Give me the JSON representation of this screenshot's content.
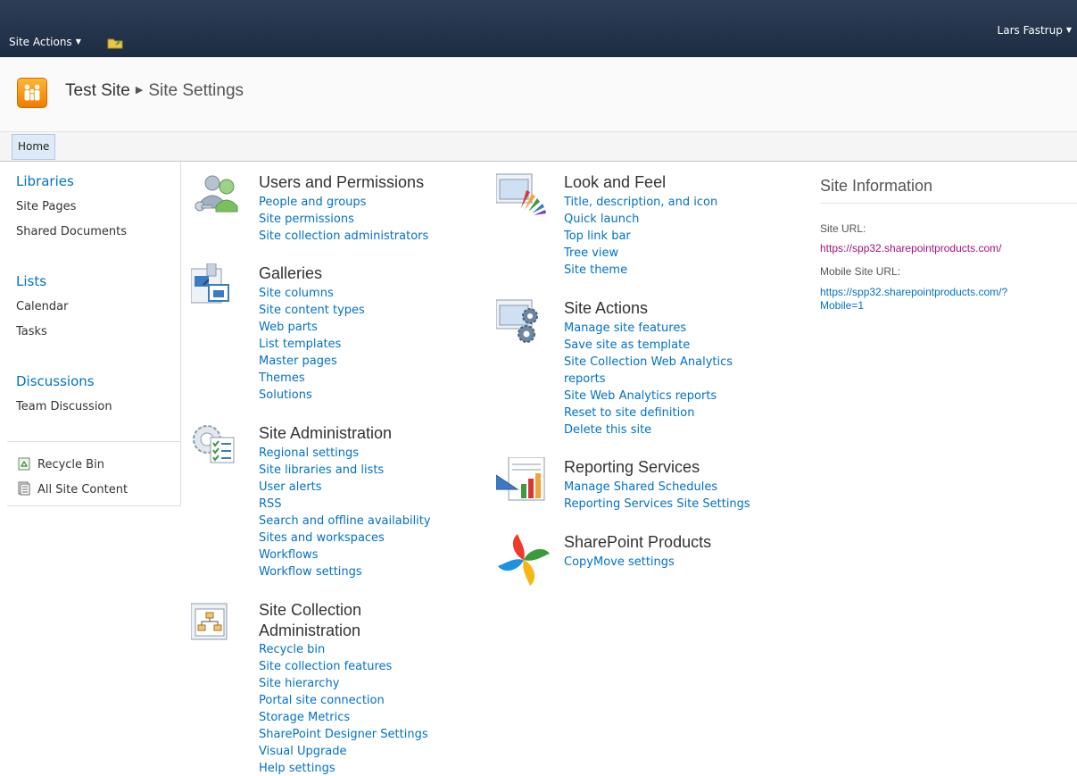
{
  "ribbon": {
    "site_actions_label": "Site Actions",
    "user_name": "Lars Fastrup"
  },
  "breadcrumb": {
    "site": "Test Site",
    "page": "Site Settings"
  },
  "topnav": {
    "home_label": "Home"
  },
  "quicklaunch": {
    "libraries_heading": "Libraries",
    "libraries": [
      "Site Pages",
      "Shared Documents"
    ],
    "lists_heading": "Lists",
    "lists": [
      "Calendar",
      "Tasks"
    ],
    "discussions_heading": "Discussions",
    "discussions": [
      "Team Discussion"
    ],
    "recycle_bin": "Recycle Bin",
    "all_site_content": "All Site Content"
  },
  "sections": {
    "users": {
      "title": "Users and Permissions",
      "links": [
        "People and groups",
        "Site permissions",
        "Site collection administrators"
      ]
    },
    "galleries": {
      "title": "Galleries",
      "links": [
        "Site columns",
        "Site content types",
        "Web parts",
        "List templates",
        "Master pages",
        "Themes",
        "Solutions"
      ]
    },
    "site_admin": {
      "title": "Site Administration",
      "links": [
        "Regional settings",
        "Site libraries and lists",
        "User alerts",
        "RSS",
        "Search and offline availability",
        "Sites and workspaces",
        "Workflows",
        "Workflow settings"
      ]
    },
    "collection_admin": {
      "title_line1": "Site Collection",
      "title_line2": "Administration",
      "links": [
        "Recycle bin",
        "Site collection features",
        "Site hierarchy",
        "Portal site connection",
        "Storage Metrics",
        "SharePoint Designer Settings",
        "Visual Upgrade",
        "Help settings"
      ]
    },
    "look_feel": {
      "title": "Look and Feel",
      "links": [
        "Title, description, and icon",
        "Quick launch",
        "Top link bar",
        "Tree view",
        "Site theme"
      ]
    },
    "site_actions": {
      "title": "Site Actions",
      "links": [
        "Manage site features",
        "Save site as template",
        "Site Collection Web Analytics",
        "reports",
        "Site Web Analytics reports",
        "Reset to site definition",
        "Delete this site"
      ]
    },
    "reporting": {
      "title": "Reporting Services",
      "links": [
        "Manage Shared Schedules",
        "Reporting Services Site Settings"
      ]
    },
    "sharepoint_products": {
      "title": "SharePoint Products",
      "links": [
        "CopyMove settings"
      ]
    }
  },
  "site_information": {
    "title": "Site Information",
    "site_url_label": "Site URL:",
    "site_url": "https://spp32.sharepointproducts.com/",
    "mobile_url_label": "Mobile Site URL:",
    "mobile_url_line1": "https://spp32.sharepointproducts.com/?",
    "mobile_url_line2": "Mobile=1",
    "site_url_color": "#a3137c",
    "mobile_url_color": "#0072c6"
  }
}
